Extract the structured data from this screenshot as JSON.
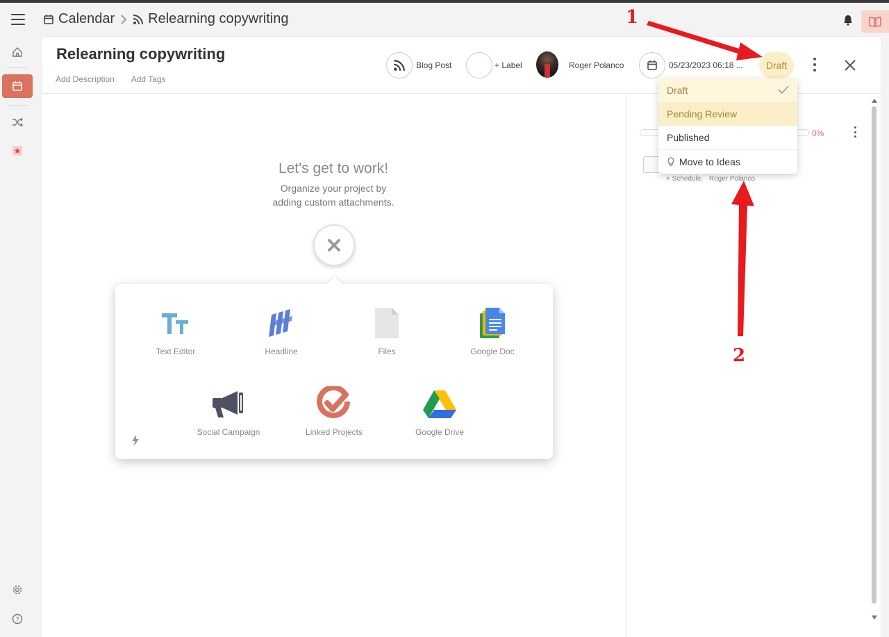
{
  "topbar": {
    "crumb_calendar": "Calendar",
    "crumb_project": "Relearning copywriting"
  },
  "project": {
    "title": "Relearning copywriting",
    "add_description": "Add Description",
    "add_tags": "Add Tags",
    "type_label": "Blog Post",
    "label_button": "+ Label",
    "owner": "Roger Polanco",
    "date": "05/23/2023 06:18 ...",
    "status": "Draft"
  },
  "empty_state": {
    "heading": "Let's get to work!",
    "line1": "Organize your project by",
    "line2": "adding custom attachments."
  },
  "attachments": [
    {
      "label": "Text Editor"
    },
    {
      "label": "Headline"
    },
    {
      "label": "Files"
    },
    {
      "label": "Google Doc"
    },
    {
      "label": "Social Campaign"
    },
    {
      "label": "Linked Projects"
    },
    {
      "label": "Google Drive"
    }
  ],
  "right_panel": {
    "progress_percent": 0,
    "progress_text": "0%",
    "schedule_link": "+ Schedule,",
    "assignee": "Roger Polanco"
  },
  "status_menu": {
    "items": [
      {
        "label": "Draft",
        "selected": true
      },
      {
        "label": "Pending Review"
      },
      {
        "label": "Published"
      },
      {
        "label": "Move to Ideas"
      }
    ]
  },
  "annotations": {
    "one": "1",
    "two": "2"
  },
  "colors": {
    "accent": "#d9725f",
    "draft": "#b08a2c",
    "arrow": "#e8191f"
  }
}
